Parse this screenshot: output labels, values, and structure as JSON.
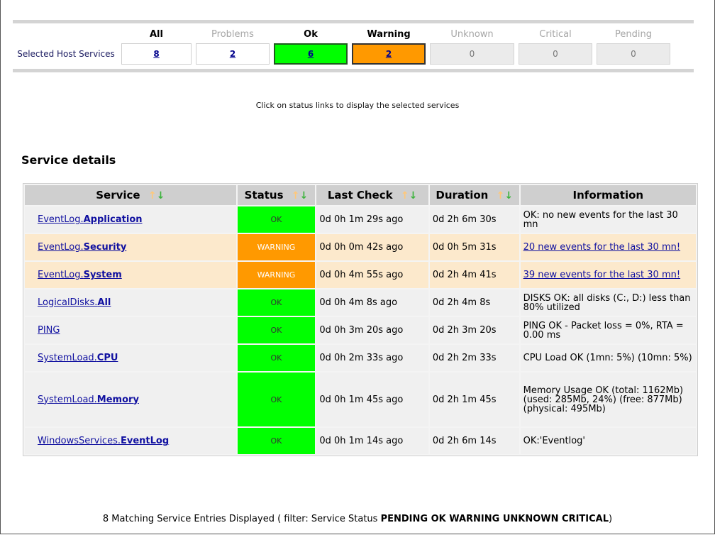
{
  "summary": {
    "row_label": "Selected Host Services",
    "headers": [
      "All",
      "Problems",
      "Ok",
      "Warning",
      "Unknown",
      "Critical",
      "Pending"
    ],
    "counts": [
      "8",
      "2",
      "6",
      "2",
      "0",
      "0",
      "0"
    ],
    "colors": {
      "ok": "#00ff00",
      "warning": "#ff9900",
      "inactive": "#ebebeb"
    }
  },
  "hint": "Click on status links to display the selected services",
  "section_title": "Service details",
  "table": {
    "columns": [
      "Service",
      "Status",
      "Last Check",
      "Duration",
      "Information"
    ],
    "rows": [
      {
        "service_prefix": "EventLog.",
        "service_bold": "Application",
        "status": "OK",
        "last_check": "0d 0h 1m 29s ago",
        "duration": "0d 2h 6m 30s",
        "info": "OK: no new events for the last 30 mn"
      },
      {
        "service_prefix": "EventLog.",
        "service_bold": "Security",
        "status": "WARNING",
        "last_check": "0d 0h 0m 42s ago",
        "duration": "0d 0h 5m 31s",
        "info": "20 new events for the last 30 mn!"
      },
      {
        "service_prefix": "EventLog.",
        "service_bold": "System",
        "status": "WARNING",
        "last_check": "0d 0h 4m 55s ago",
        "duration": "0d 2h 4m 41s",
        "info": "39 new events for the last 30 mn!"
      },
      {
        "service_prefix": "LogicalDisks.",
        "service_bold": "All",
        "status": "OK",
        "last_check": "0d 0h 4m 8s ago",
        "duration": "0d 2h 4m 8s",
        "info": "DISKS OK: all disks (C:, D:) less than 80% utilized"
      },
      {
        "service_prefix": "PING",
        "service_bold": "",
        "status": "OK",
        "last_check": "0d 0h 3m 20s ago",
        "duration": "0d 2h 3m 20s",
        "info": "PING OK - Packet loss = 0%, RTA = 0.00 ms"
      },
      {
        "service_prefix": "SystemLoad.",
        "service_bold": "CPU",
        "status": "OK",
        "last_check": "0d 0h 2m 33s ago",
        "duration": "0d 2h 2m 33s",
        "info": "CPU Load OK (1mn: 5%) (10mn: 5%)"
      },
      {
        "service_prefix": "SystemLoad.",
        "service_bold": "Memory",
        "status": "OK",
        "last_check": "0d 0h 1m 45s ago",
        "duration": "0d 2h 1m 45s",
        "info": "Memory Usage OK (total: 1162Mb) (used: 285Mb, 24%) (free: 877Mb) (physical: 495Mb)"
      },
      {
        "service_prefix": "WindowsServices.",
        "service_bold": "EventLog",
        "status": "OK",
        "last_check": "0d 0h 1m 14s ago",
        "duration": "0d 2h 6m 14s",
        "info": "OK:'Eventlog'"
      }
    ]
  },
  "footer": {
    "prefix": "8 Matching Service Entries Displayed ( filter: Service Status ",
    "filters": "PENDING OK WARNING UNKNOWN CRITICAL",
    "suffix": ")"
  }
}
